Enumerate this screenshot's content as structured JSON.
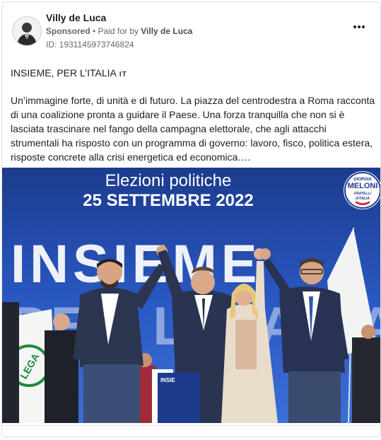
{
  "post": {
    "author_name": "Villy de Luca",
    "sponsored_label": "Sponsored",
    "paid_for_prefix": " • Paid for by ",
    "payer_name": "Villy de Luca",
    "ad_id": "ID: 1931145973746824",
    "headline": "INSIEME, PER L’ITALIA",
    "headline_flag": "IT",
    "body": "Un’immagine forte, di unità e di futuro. La piazza del centrodestra a Roma racconta di una coalizione pronta a guidare il Paese. Una forza tranquilla che non si è lasciata trascinare nel fango della campagna elettorale, che agli attacchi strumentali ha risposto con un programma di governo: lavoro, fisco, politica estera, risposte concrete alla crisi energetica ed economica…."
  },
  "image": {
    "banner_line1": "Elezioni politiche",
    "banner_line2": "25 SETTEMBRE 2022",
    "big_text": "INSIEME",
    "big_text_2": "PER L'ITALIA",
    "logo_top": "GIORGIA",
    "logo_name": "MELONI",
    "logo_sub1": "FRATELLI",
    "logo_sub2": "d'ITALIA",
    "flag_text": "LEGA",
    "podium_text": "INSIE"
  },
  "colors": {
    "banner_blue": "#1d3a8a",
    "sky_blue": "#2b57c0"
  }
}
